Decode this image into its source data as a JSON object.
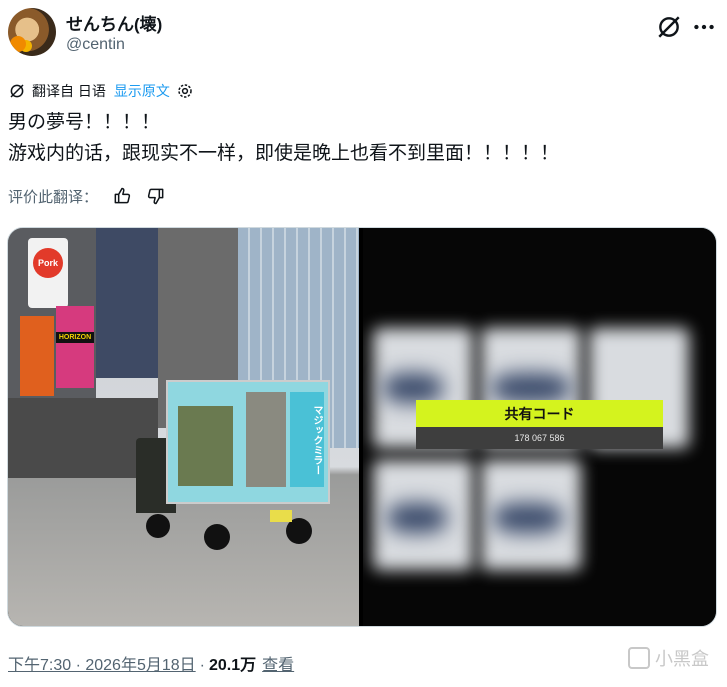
{
  "author": {
    "display_name": "せんちん(壊)",
    "handle": "@centin"
  },
  "translation": {
    "translated_from": "翻译自 日语",
    "show_original": "显示原文"
  },
  "tweet": {
    "line1": "男の夢号！！！！",
    "line2": "游戏内的话，跟现实不一样，即使是晚上也看不到里面！！！！！"
  },
  "rating": {
    "label": "评价此翻译："
  },
  "media": {
    "left_sign_brand": "HORIZON",
    "left_sign_pork": "Pork",
    "truck_side_text": "マジックミラー",
    "share_title": "共有コード",
    "share_code": "178 067 586"
  },
  "meta": {
    "time": "下午7:30 · 2026年5月18日",
    "views": "20.1万",
    "views_label": "查看"
  },
  "watermark": "小黑盒",
  "colors": {
    "link": "#1d9bf0",
    "accent_lime": "#d4f31e"
  }
}
